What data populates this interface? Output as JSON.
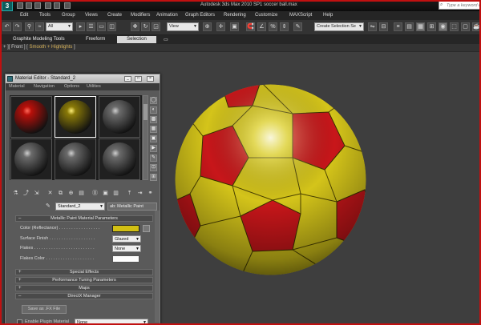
{
  "app": {
    "title": "Autodesk 3ds Max  2010 SP1     soccer ball.max",
    "logo_text": "3",
    "search_placeholder": "Type a keyword or phrase"
  },
  "menu": [
    "Edit",
    "Tools",
    "Group",
    "Views",
    "Create",
    "Modifiers",
    "Animation",
    "Graph Editors",
    "Rendering",
    "Customize",
    "MAXScript",
    "Help"
  ],
  "toolbar": {
    "filter_value": "All",
    "view_value": "View",
    "selection_set_value": "Create Selection Se"
  },
  "ribbon": {
    "tabs": [
      "Graphite Modeling Tools",
      "Freeform",
      "Selection"
    ],
    "active_tab": "Selection"
  },
  "viewport": {
    "label_prefix": "+ ][ Front ] [ ",
    "label_shading": "Smooth + Highlights",
    "label_suffix": " ]",
    "ball_colors": {
      "yellow": "#d4c41a",
      "red": "#c8161a"
    }
  },
  "material_editor": {
    "title": "Material Editor - Standard_2",
    "menu": [
      "Material",
      "Navigation",
      "Options",
      "Utilities"
    ],
    "window_buttons": [
      "_",
      "□",
      "×"
    ],
    "slots": [
      {
        "color": "#b8100a",
        "highlight": "#ff6a5a"
      },
      {
        "color": "#8a7a08",
        "highlight": "#fff07a"
      },
      {
        "color": "#6b6b6b",
        "highlight": "#d0d0d0"
      },
      {
        "color": "#6b6b6b",
        "highlight": "#d0d0d0"
      },
      {
        "color": "#6b6b6b",
        "highlight": "#d0d0d0"
      },
      {
        "color": "#6b6b6b",
        "highlight": "#d0d0d0"
      }
    ],
    "material_name": "Standard_2",
    "material_type": "ab: Metallic Paint",
    "rollouts": {
      "metallic_paint": "Metallic Paint Material Parameters",
      "special_effects": "Special Effects",
      "performance": "Performance Tuning Parameters",
      "maps": "Maps",
      "directx": "DirectX Manager"
    },
    "params": {
      "color_label": "Color (Reflectance) . . . . . . . . . . . . . . . . .",
      "color_value": "#d2c013",
      "surface_finish_label": "Surface Finish . . . . . . . . . . . . . . . . . . .",
      "surface_finish_value": "Glazed",
      "flakes_label": "Flakes . . . . . . . . . . . . . . . . . . . . . . . . .",
      "flakes_value": "None",
      "flakes_color_label": "Flakes Color . . . . . . . . . . . . . . . . . . . .",
      "flakes_color_value": "#fdfdfd"
    },
    "directx": {
      "save_button": "Save as .FX File",
      "plugin_label": "Enable Plugin Material",
      "plugin_value": "None"
    }
  }
}
